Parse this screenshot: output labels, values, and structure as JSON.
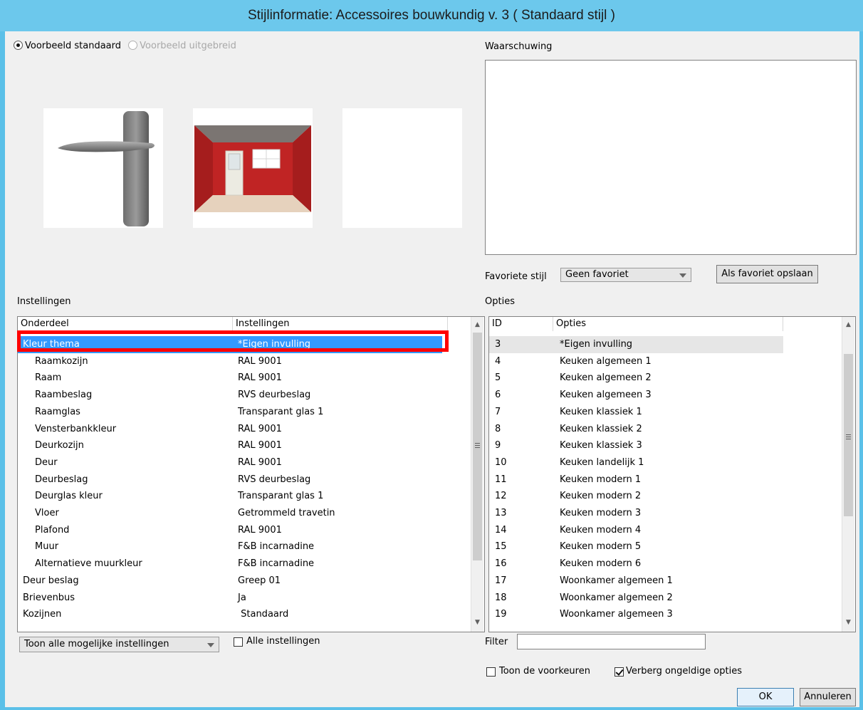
{
  "window": {
    "title": "Stijlinformatie: Accessoires bouwkundig v. 3 ( Standaard stijl )"
  },
  "preview_mode": {
    "standard": "Voorbeeld standaard",
    "extended": "Voorbeeld uitgebreid"
  },
  "warning": {
    "label": "Waarschuwing",
    "text": ""
  },
  "favorite": {
    "label": "Favoriete stijl",
    "value": "Geen favoriet",
    "save_button": "Als favoriet opslaan"
  },
  "settings": {
    "label": "Instellingen",
    "col_part": "Onderdeel",
    "col_setting": "Instellingen",
    "rows": [
      {
        "part": "Kleur thema",
        "value": "*Eigen invulling",
        "indent": false,
        "selected": true
      },
      {
        "part": "Raamkozijn",
        "value": "RAL 9001",
        "indent": true
      },
      {
        "part": "Raam",
        "value": "RAL 9001",
        "indent": true
      },
      {
        "part": "Raambeslag",
        "value": "RVS deurbeslag",
        "indent": true
      },
      {
        "part": "Raamglas",
        "value": "Transparant glas 1",
        "indent": true
      },
      {
        "part": "Vensterbankkleur",
        "value": "RAL 9001",
        "indent": true
      },
      {
        "part": "Deurkozijn",
        "value": "RAL 9001",
        "indent": true
      },
      {
        "part": "Deur",
        "value": "RAL 9001",
        "indent": true
      },
      {
        "part": "Deurbeslag",
        "value": "RVS deurbeslag",
        "indent": true
      },
      {
        "part": "Deurglas kleur",
        "value": "Transparant glas 1",
        "indent": true
      },
      {
        "part": "Vloer",
        "value": "Getrommeld travetin",
        "indent": true
      },
      {
        "part": "Plafond",
        "value": "RAL 9001",
        "indent": true
      },
      {
        "part": "Muur",
        "value": "F&B incarnadine",
        "indent": true
      },
      {
        "part": "Alternatieve muurkleur",
        "value": "F&B incarnadine",
        "indent": true
      },
      {
        "part": "Deur beslag",
        "value": "Greep 01",
        "indent": false
      },
      {
        "part": "Brievenbus",
        "value": "Ja",
        "indent": false
      },
      {
        "part": "Kozijnen",
        "value": " Standaard",
        "indent": false
      }
    ],
    "show_dropdown": "Toon alle mogelijke instellingen",
    "all_settings_checkbox": "Alle instellingen"
  },
  "options": {
    "label": "Opties",
    "col_id": "ID",
    "col_option": "Opties",
    "rows": [
      {
        "id": "3",
        "name": "*Eigen invulling",
        "selected": true
      },
      {
        "id": "4",
        "name": "Keuken algemeen 1"
      },
      {
        "id": "5",
        "name": "Keuken algemeen 2"
      },
      {
        "id": "6",
        "name": "Keuken algemeen 3"
      },
      {
        "id": "7",
        "name": "Keuken klassiek 1"
      },
      {
        "id": "8",
        "name": "Keuken klassiek 2"
      },
      {
        "id": "9",
        "name": "Keuken klassiek 3"
      },
      {
        "id": "10",
        "name": "Keuken landelijk 1"
      },
      {
        "id": "11",
        "name": "Keuken modern 1"
      },
      {
        "id": "12",
        "name": "Keuken modern 2"
      },
      {
        "id": "13",
        "name": "Keuken modern 3"
      },
      {
        "id": "14",
        "name": "Keuken modern 4"
      },
      {
        "id": "15",
        "name": "Keuken modern 5"
      },
      {
        "id": "16",
        "name": "Keuken modern 6"
      },
      {
        "id": "17",
        "name": "Woonkamer algemeen 1"
      },
      {
        "id": "18",
        "name": "Woonkamer algemeen 2"
      },
      {
        "id": "19",
        "name": "Woonkamer algemeen 3"
      }
    ],
    "filter_label": "Filter",
    "filter_value": "",
    "show_prefs_checkbox": "Toon de voorkeuren",
    "hide_invalid_checkbox": "Verberg ongeldige opties"
  },
  "buttons": {
    "ok": "OK",
    "cancel": "Annuleren"
  },
  "colors": {
    "selection": "#3399ff",
    "highlight_frame": "#ff0000",
    "title_bar": "#6cc8ec"
  }
}
